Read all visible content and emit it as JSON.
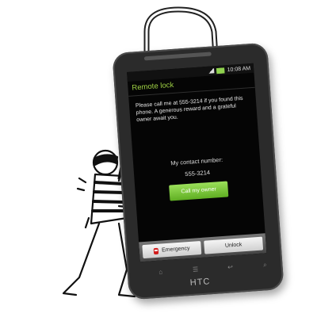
{
  "status_bar": {
    "time": "10:08 AM"
  },
  "app": {
    "title": "Remote lock",
    "message": "Please call me at 555-3214 if you found this phone. A generous reward and a grateful owner await you.",
    "contact_label": "My contact number:",
    "contact_number": "555-3214",
    "call_button": "Call my owner"
  },
  "bottom_buttons": {
    "emergency": "Emergency",
    "unlock": "Unlock"
  },
  "hardware": {
    "brand": "HTC"
  },
  "icons": [
    "lock-shackle-icon",
    "emergency-icon",
    "home-icon",
    "menu-icon",
    "back-icon",
    "search-icon",
    "thief-figure"
  ],
  "colors": {
    "accent": "#9fd144",
    "call_button": "#6dbb2a",
    "emergency": "#d21c1c"
  }
}
